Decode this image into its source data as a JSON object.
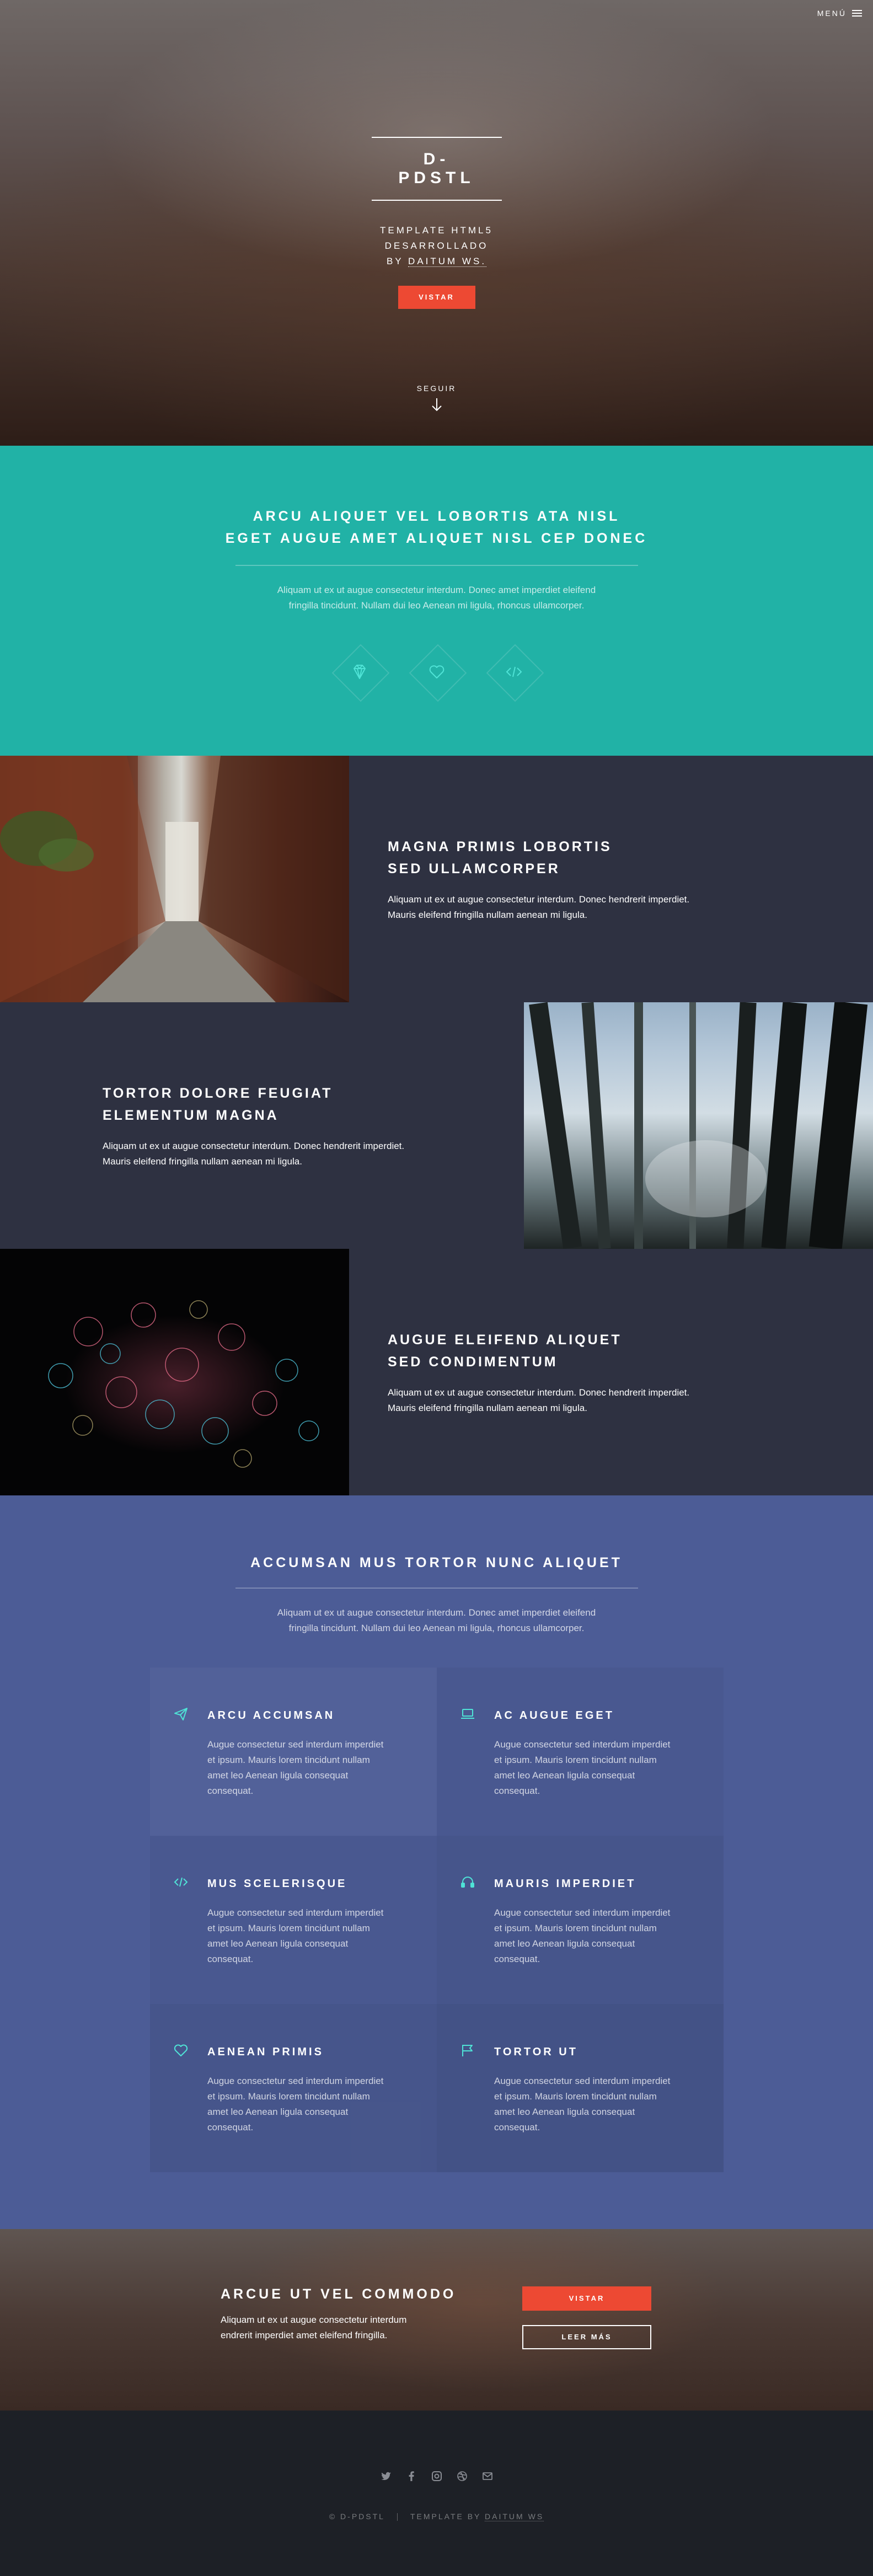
{
  "colors": {
    "accent": "#ed4933",
    "section_one_bg": "#21b2a6",
    "spotlight_bg": "#2e3141",
    "section_two_bg": "#4c5c96",
    "footer_bg": "#1d2026",
    "icon_teal": "#4fe3d6"
  },
  "header": {
    "menu_label": "MENÚ",
    "menu_icon": "hamburger-icon"
  },
  "banner": {
    "logo": "D-PDSTL",
    "tagline_1": "TEMPLATE HTML5",
    "tagline_2": "DESARROLLADO",
    "tagline_prefix": "BY",
    "tagline_link": "DAITUM WS.",
    "button_label": "VISTAR",
    "scroll_label": "SEGUIR",
    "scroll_icon": "arrow-down-icon"
  },
  "one": {
    "heading_1": "ARCU ALIQUET VEL LOBORTIS ATA NISL",
    "heading_2": "EGET AUGUE AMET ALIQUET NISL CEP DONEC",
    "text_1": "Aliquam ut ex ut augue consectetur interdum. Donec amet imperdiet eleifend",
    "text_2": "fringilla tincidunt. Nullam dui leo Aenean mi ligula, rhoncus ullamcorper.",
    "icons": [
      "diamond-icon",
      "heart-icon",
      "code-icon"
    ]
  },
  "spotlights": [
    {
      "image": "alley-photo",
      "title_1": "MAGNA PRIMIS LOBORTIS",
      "title_2": "SED ULLAMCORPER",
      "text_1": "Aliquam ut ex ut augue consectetur interdum. Donec hendrerit imperdiet.",
      "text_2": "Mauris eleifend fringilla nullam aenean mi ligula."
    },
    {
      "image": "forest-photo",
      "title_1": "TORTOR DOLORE FEUGIAT",
      "title_2": "ELEMENTUM MAGNA",
      "text_1": "Aliquam ut ex ut augue consectetur interdum. Donec hendrerit imperdiet.",
      "text_2": "Mauris eleifend fringilla nullam aenean mi ligula."
    },
    {
      "image": "fireworks-photo",
      "title_1": "AUGUE ELEIFEND ALIQUET",
      "title_2": "SED CONDIMENTUM",
      "text_1": "Aliquam ut ex ut augue consectetur interdum. Donec hendrerit imperdiet.",
      "text_2": "Mauris eleifend fringilla nullam aenean mi ligula."
    }
  ],
  "two": {
    "heading": "ACCUMSAN MUS TORTOR NUNC ALIQUET",
    "text_1": "Aliquam ut ex ut augue consectetur interdum. Donec amet imperdiet eleifend",
    "text_2": "fringilla tincidunt. Nullam dui leo Aenean mi ligula, rhoncus ullamcorper.",
    "features": [
      {
        "icon": "paper-plane-icon",
        "title": "ARCU ACCUMSAN",
        "text": "Augue consectetur sed interdum imperdiet et ipsum. Mauris lorem tincidunt nullam amet leo Aenean ligula consequat consequat."
      },
      {
        "icon": "laptop-icon",
        "title": "AC AUGUE EGET",
        "text": "Augue consectetur sed interdum imperdiet et ipsum. Mauris lorem tincidunt nullam amet leo Aenean ligula consequat consequat."
      },
      {
        "icon": "code-icon",
        "title": "MUS SCELERISQUE",
        "text": "Augue consectetur sed interdum imperdiet et ipsum. Mauris lorem tincidunt nullam amet leo Aenean ligula consequat consequat."
      },
      {
        "icon": "headphones-icon",
        "title": "MAURIS IMPERDIET",
        "text": "Augue consectetur sed interdum imperdiet et ipsum. Mauris lorem tincidunt nullam amet leo Aenean ligula consequat consequat."
      },
      {
        "icon": "heart-icon",
        "title": "AENEAN PRIMIS",
        "text": "Augue consectetur sed interdum imperdiet et ipsum. Mauris lorem tincidunt nullam amet leo Aenean ligula consequat consequat."
      },
      {
        "icon": "flag-icon",
        "title": "TORTOR UT",
        "text": "Augue consectetur sed interdum imperdiet et ipsum. Mauris lorem tincidunt nullam amet leo Aenean ligula consequat consequat."
      }
    ]
  },
  "cta": {
    "heading": "ARCUE UT VEL COMMODO",
    "text_1": "Aliquam ut ex ut augue consectetur interdum",
    "text_2": "endrerit imperdiet amet eleifend fringilla.",
    "primary_label": "VISTAR",
    "secondary_label": "LEER MÁS"
  },
  "footer": {
    "social_icons": [
      "twitter-icon",
      "facebook-icon",
      "instagram-icon",
      "dribbble-icon",
      "email-icon"
    ],
    "copyright": "© D-PDSTL",
    "credit_prefix": "TEMPLATE BY",
    "credit_link": "DAITUM WS"
  }
}
